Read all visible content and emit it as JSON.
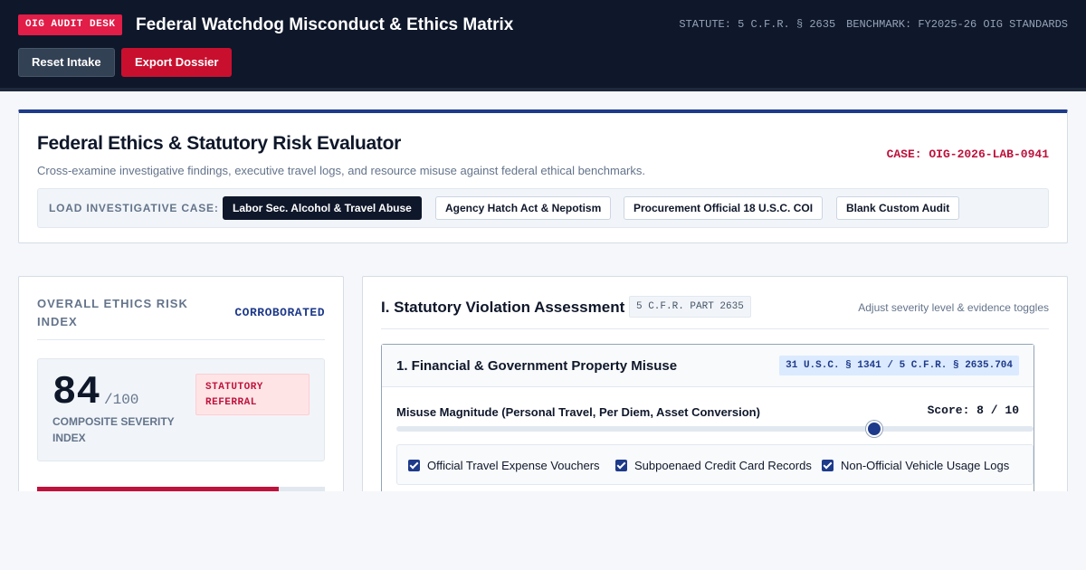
{
  "header": {
    "badge": "OIG AUDIT DESK",
    "title": "Federal Watchdog Misconduct & Ethics Matrix",
    "statute": "STATUTE: 5 C.F.R. § 2635",
    "benchmark": "BENCHMARK: FY2025-26 OIG STANDARDS",
    "reset_label": "Reset Intake",
    "export_label": "Export Dossier"
  },
  "evaluator": {
    "title": "Federal Ethics & Statutory Risk Evaluator",
    "subtitle": "Cross-examine investigative findings, executive travel logs, and resource misuse against federal ethical benchmarks.",
    "case_id": "CASE: OIG-2026-LAB-0941",
    "loader_label": "LOAD INVESTIGATIVE CASE:",
    "cases": [
      {
        "label": "Labor Sec. Alcohol & Travel Abuse",
        "active": true
      },
      {
        "label": "Agency Hatch Act & Nepotism",
        "active": false
      },
      {
        "label": "Procurement Official 18 U.S.C. COI",
        "active": false
      },
      {
        "label": "Blank Custom Audit",
        "active": false
      }
    ]
  },
  "risk": {
    "label": "OVERALL ETHICS RISK INDEX",
    "status": "CORROBORATED",
    "score": "84",
    "max": "/100",
    "caption": "COMPOSITE SEVERITY INDEX",
    "referral": "STATUTORY REFERRAL",
    "fraction": 0.84
  },
  "assessment": {
    "title": "I. Statutory Violation Assessment",
    "tag": "5 C.F.R. PART 2635",
    "hint": "Adjust severity level & evidence toggles",
    "section": {
      "title": "1. Financial & Government Property Misuse",
      "citation": "31 U.S.C. § 1341 / 5 C.F.R. § 2635.704",
      "magnitude_label": "Misuse Magnitude (Personal Travel, Per Diem, Asset Conversion)",
      "score_text": "Score: 8 / 10",
      "slider_value": 8,
      "slider_max": 10,
      "evidence": [
        {
          "label": "Official Travel Expense Vouchers",
          "checked": true
        },
        {
          "label": "Subpoenaed Credit Card Records",
          "checked": true
        },
        {
          "label": "Non-Official Vehicle Usage Logs",
          "checked": true
        }
      ]
    }
  }
}
